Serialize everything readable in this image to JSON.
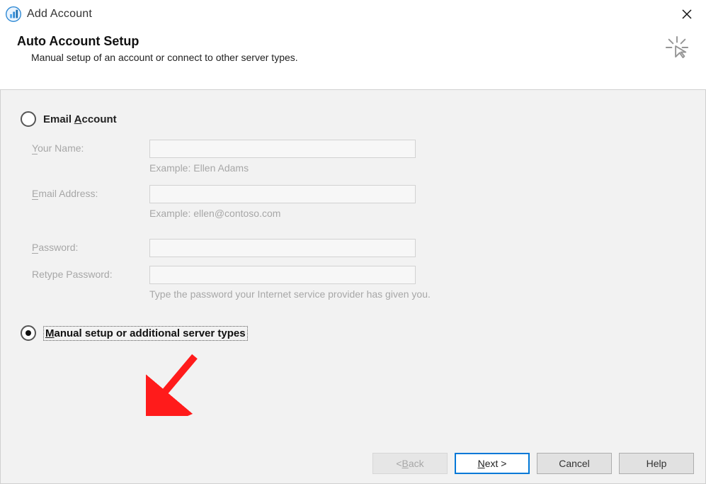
{
  "window": {
    "title": "Add Account"
  },
  "header": {
    "title": "Auto Account Setup",
    "subtitle": "Manual setup of an account or connect to other server types."
  },
  "options": {
    "email_account": {
      "label": "Email Account",
      "selected": false
    },
    "manual_setup": {
      "label": "Manual setup or additional server types",
      "selected": true
    }
  },
  "fields": {
    "your_name": {
      "label": "Your Name:",
      "value": "",
      "hint": "Example: Ellen Adams"
    },
    "email": {
      "label": "Email Address:",
      "value": "",
      "hint": "Example: ellen@contoso.com"
    },
    "password": {
      "label": "Password:",
      "value": ""
    },
    "retype_password": {
      "label": "Retype Password:",
      "value": ""
    },
    "password_hint": "Type the password your Internet service provider has given you."
  },
  "footer": {
    "back": "< Back",
    "next": "Next >",
    "cancel": "Cancel",
    "help": "Help"
  }
}
